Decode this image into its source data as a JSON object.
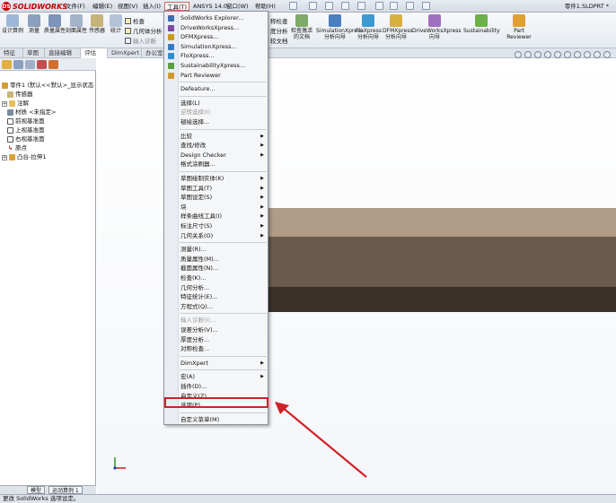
{
  "app": {
    "logo_text": "SOLIDWORKS",
    "document_title": "零件1.SLDPRT *"
  },
  "menubar": {
    "items": [
      "文件(F)",
      "编辑(E)",
      "视图(V)",
      "插入(I)",
      "工具(T)",
      "ANSYS 14.0",
      "窗口(W)",
      "帮助(H)"
    ],
    "active_index": 4
  },
  "command_manager": {
    "left_buttons": [
      "设计算例",
      "测量",
      "质量属性",
      "剖面属性",
      "传感器",
      "统计"
    ],
    "checkboxes": [
      "检查",
      "几何体分析",
      "输入诊断"
    ],
    "right_buttons": [
      "检查激活的文档",
      "SimulationXpress 分析向导",
      "FloXpress 分析向导",
      "DFMXpress 分析向导",
      "DriveWorksXpress 向导",
      "Sustainability",
      "Part Reviewer"
    ],
    "partial_labels": [
      "称检查",
      "度分析",
      "较文档"
    ]
  },
  "tabs": [
    "特征",
    "草图",
    "直接编辑",
    "评估",
    "DimXpert",
    "办公室产"
  ],
  "selected_tab": "评估",
  "feature_tree": {
    "root": "零件1 (默认<<默认>_显示状态",
    "items": [
      "传感器",
      "注解",
      "材质 <未指定>",
      "前视基准面",
      "上视基准面",
      "右视基准面",
      "原点",
      "凸台-拉伸1"
    ]
  },
  "panel_bottom_tabs": [
    "模型",
    "运动算例 1"
  ],
  "status_text": "更改 SolidWorks 选项设定。",
  "dropdown_menu": {
    "items": [
      {
        "label": "SolidWorks Explorer...",
        "type": "item"
      },
      {
        "label": "DriveWorksXpress...",
        "type": "item"
      },
      {
        "label": "DFMXpress...",
        "type": "item"
      },
      {
        "label": "SimulationXpress...",
        "type": "item"
      },
      {
        "label": "FloXpress...",
        "type": "item"
      },
      {
        "label": "SustainabilityXpress...",
        "type": "item"
      },
      {
        "label": "Part Reviewer",
        "type": "item"
      },
      {
        "type": "sep"
      },
      {
        "label": "Defeature...",
        "type": "item"
      },
      {
        "type": "sep"
      },
      {
        "label": "选择(L)",
        "type": "item"
      },
      {
        "label": "逆转选择(I)",
        "type": "disabled"
      },
      {
        "label": "褪绘选择...",
        "type": "item"
      },
      {
        "type": "sep"
      },
      {
        "label": "比较",
        "type": "sub"
      },
      {
        "label": "查找/修改",
        "type": "sub"
      },
      {
        "label": "Design Checker",
        "type": "sub"
      },
      {
        "label": "格式涂刷器...",
        "type": "item"
      },
      {
        "type": "sep"
      },
      {
        "label": "草图绘制实体(K)",
        "type": "sub"
      },
      {
        "label": "草图工具(T)",
        "type": "sub"
      },
      {
        "label": "草图设定(S)",
        "type": "sub"
      },
      {
        "label": "块",
        "type": "sub"
      },
      {
        "label": "样条曲线工具(I)",
        "type": "sub"
      },
      {
        "label": "标注尺寸(S)",
        "type": "sub"
      },
      {
        "label": "几何关系(O)",
        "type": "sub"
      },
      {
        "type": "sep"
      },
      {
        "label": "测量(R)...",
        "type": "item"
      },
      {
        "label": "质量属性(M)...",
        "type": "item"
      },
      {
        "label": "截面属性(N)...",
        "type": "item"
      },
      {
        "label": "检查(K)...",
        "type": "item"
      },
      {
        "label": "几何分析...",
        "type": "item"
      },
      {
        "label": "特征统计(E)...",
        "type": "item"
      },
      {
        "label": "方程式(Q)...",
        "type": "item"
      },
      {
        "type": "sep"
      },
      {
        "label": "输入诊断(I)...",
        "type": "disabled"
      },
      {
        "label": "误差分析(V)...",
        "type": "item"
      },
      {
        "label": "厚度分析...",
        "type": "item"
      },
      {
        "label": "对称检查...",
        "type": "item"
      },
      {
        "type": "sep"
      },
      {
        "label": "DimXpert",
        "type": "sub"
      },
      {
        "type": "sep"
      },
      {
        "label": "宏(A)",
        "type": "sub"
      },
      {
        "label": "插件(D)...",
        "type": "item"
      },
      {
        "label": "自定义(Z)...",
        "type": "item"
      },
      {
        "label": "选项(P)...",
        "type": "highlight"
      },
      {
        "type": "sep"
      },
      {
        "label": "自定义菜单(M)",
        "type": "item"
      }
    ]
  },
  "colors": {
    "highlight_box": "#d0202a",
    "arrow": "#d0202a",
    "part_top": "#b09b86",
    "part_mid": "#6a5a4b",
    "part_bottom": "#3c3128"
  }
}
